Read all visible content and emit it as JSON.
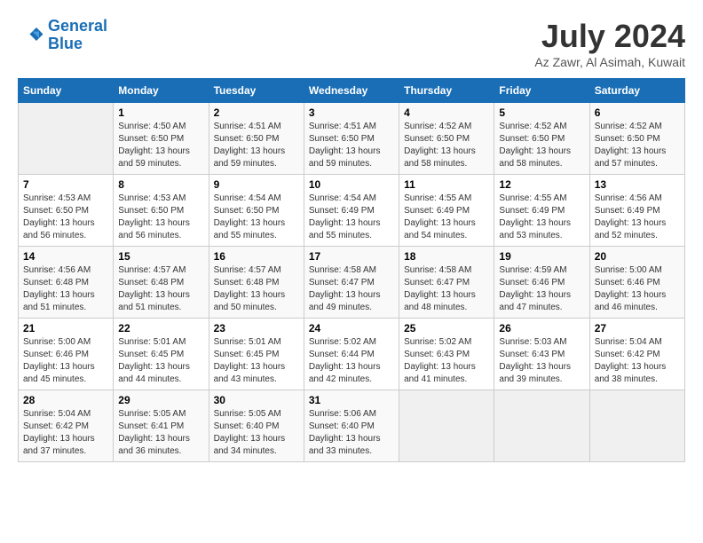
{
  "logo": {
    "line1": "General",
    "line2": "Blue"
  },
  "title": "July 2024",
  "location": "Az Zawr, Al Asimah, Kuwait",
  "weekdays": [
    "Sunday",
    "Monday",
    "Tuesday",
    "Wednesday",
    "Thursday",
    "Friday",
    "Saturday"
  ],
  "weeks": [
    [
      {
        "day": "",
        "sunrise": "",
        "sunset": "",
        "daylight": ""
      },
      {
        "day": "1",
        "sunrise": "Sunrise: 4:50 AM",
        "sunset": "Sunset: 6:50 PM",
        "daylight": "Daylight: 13 hours and 59 minutes."
      },
      {
        "day": "2",
        "sunrise": "Sunrise: 4:51 AM",
        "sunset": "Sunset: 6:50 PM",
        "daylight": "Daylight: 13 hours and 59 minutes."
      },
      {
        "day": "3",
        "sunrise": "Sunrise: 4:51 AM",
        "sunset": "Sunset: 6:50 PM",
        "daylight": "Daylight: 13 hours and 59 minutes."
      },
      {
        "day": "4",
        "sunrise": "Sunrise: 4:52 AM",
        "sunset": "Sunset: 6:50 PM",
        "daylight": "Daylight: 13 hours and 58 minutes."
      },
      {
        "day": "5",
        "sunrise": "Sunrise: 4:52 AM",
        "sunset": "Sunset: 6:50 PM",
        "daylight": "Daylight: 13 hours and 58 minutes."
      },
      {
        "day": "6",
        "sunrise": "Sunrise: 4:52 AM",
        "sunset": "Sunset: 6:50 PM",
        "daylight": "Daylight: 13 hours and 57 minutes."
      }
    ],
    [
      {
        "day": "7",
        "sunrise": "Sunrise: 4:53 AM",
        "sunset": "Sunset: 6:50 PM",
        "daylight": "Daylight: 13 hours and 56 minutes."
      },
      {
        "day": "8",
        "sunrise": "Sunrise: 4:53 AM",
        "sunset": "Sunset: 6:50 PM",
        "daylight": "Daylight: 13 hours and 56 minutes."
      },
      {
        "day": "9",
        "sunrise": "Sunrise: 4:54 AM",
        "sunset": "Sunset: 6:50 PM",
        "daylight": "Daylight: 13 hours and 55 minutes."
      },
      {
        "day": "10",
        "sunrise": "Sunrise: 4:54 AM",
        "sunset": "Sunset: 6:49 PM",
        "daylight": "Daylight: 13 hours and 55 minutes."
      },
      {
        "day": "11",
        "sunrise": "Sunrise: 4:55 AM",
        "sunset": "Sunset: 6:49 PM",
        "daylight": "Daylight: 13 hours and 54 minutes."
      },
      {
        "day": "12",
        "sunrise": "Sunrise: 4:55 AM",
        "sunset": "Sunset: 6:49 PM",
        "daylight": "Daylight: 13 hours and 53 minutes."
      },
      {
        "day": "13",
        "sunrise": "Sunrise: 4:56 AM",
        "sunset": "Sunset: 6:49 PM",
        "daylight": "Daylight: 13 hours and 52 minutes."
      }
    ],
    [
      {
        "day": "14",
        "sunrise": "Sunrise: 4:56 AM",
        "sunset": "Sunset: 6:48 PM",
        "daylight": "Daylight: 13 hours and 51 minutes."
      },
      {
        "day": "15",
        "sunrise": "Sunrise: 4:57 AM",
        "sunset": "Sunset: 6:48 PM",
        "daylight": "Daylight: 13 hours and 51 minutes."
      },
      {
        "day": "16",
        "sunrise": "Sunrise: 4:57 AM",
        "sunset": "Sunset: 6:48 PM",
        "daylight": "Daylight: 13 hours and 50 minutes."
      },
      {
        "day": "17",
        "sunrise": "Sunrise: 4:58 AM",
        "sunset": "Sunset: 6:47 PM",
        "daylight": "Daylight: 13 hours and 49 minutes."
      },
      {
        "day": "18",
        "sunrise": "Sunrise: 4:58 AM",
        "sunset": "Sunset: 6:47 PM",
        "daylight": "Daylight: 13 hours and 48 minutes."
      },
      {
        "day": "19",
        "sunrise": "Sunrise: 4:59 AM",
        "sunset": "Sunset: 6:46 PM",
        "daylight": "Daylight: 13 hours and 47 minutes."
      },
      {
        "day": "20",
        "sunrise": "Sunrise: 5:00 AM",
        "sunset": "Sunset: 6:46 PM",
        "daylight": "Daylight: 13 hours and 46 minutes."
      }
    ],
    [
      {
        "day": "21",
        "sunrise": "Sunrise: 5:00 AM",
        "sunset": "Sunset: 6:46 PM",
        "daylight": "Daylight: 13 hours and 45 minutes."
      },
      {
        "day": "22",
        "sunrise": "Sunrise: 5:01 AM",
        "sunset": "Sunset: 6:45 PM",
        "daylight": "Daylight: 13 hours and 44 minutes."
      },
      {
        "day": "23",
        "sunrise": "Sunrise: 5:01 AM",
        "sunset": "Sunset: 6:45 PM",
        "daylight": "Daylight: 13 hours and 43 minutes."
      },
      {
        "day": "24",
        "sunrise": "Sunrise: 5:02 AM",
        "sunset": "Sunset: 6:44 PM",
        "daylight": "Daylight: 13 hours and 42 minutes."
      },
      {
        "day": "25",
        "sunrise": "Sunrise: 5:02 AM",
        "sunset": "Sunset: 6:43 PM",
        "daylight": "Daylight: 13 hours and 41 minutes."
      },
      {
        "day": "26",
        "sunrise": "Sunrise: 5:03 AM",
        "sunset": "Sunset: 6:43 PM",
        "daylight": "Daylight: 13 hours and 39 minutes."
      },
      {
        "day": "27",
        "sunrise": "Sunrise: 5:04 AM",
        "sunset": "Sunset: 6:42 PM",
        "daylight": "Daylight: 13 hours and 38 minutes."
      }
    ],
    [
      {
        "day": "28",
        "sunrise": "Sunrise: 5:04 AM",
        "sunset": "Sunset: 6:42 PM",
        "daylight": "Daylight: 13 hours and 37 minutes."
      },
      {
        "day": "29",
        "sunrise": "Sunrise: 5:05 AM",
        "sunset": "Sunset: 6:41 PM",
        "daylight": "Daylight: 13 hours and 36 minutes."
      },
      {
        "day": "30",
        "sunrise": "Sunrise: 5:05 AM",
        "sunset": "Sunset: 6:40 PM",
        "daylight": "Daylight: 13 hours and 34 minutes."
      },
      {
        "day": "31",
        "sunrise": "Sunrise: 5:06 AM",
        "sunset": "Sunset: 6:40 PM",
        "daylight": "Daylight: 13 hours and 33 minutes."
      },
      {
        "day": "",
        "sunrise": "",
        "sunset": "",
        "daylight": ""
      },
      {
        "day": "",
        "sunrise": "",
        "sunset": "",
        "daylight": ""
      },
      {
        "day": "",
        "sunrise": "",
        "sunset": "",
        "daylight": ""
      }
    ]
  ]
}
